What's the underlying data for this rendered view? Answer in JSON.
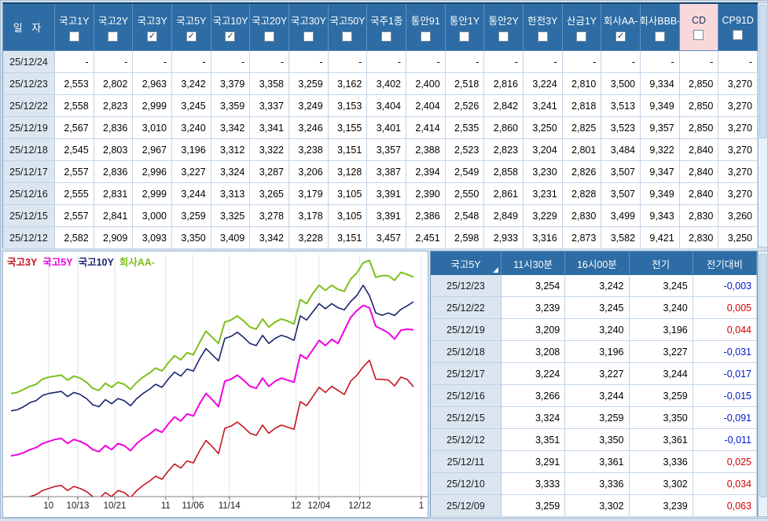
{
  "colors": {
    "header_bg": "#2D6CA4",
    "header_highlight_bg": "#F8D8DA",
    "date_col_bg": "#DCE6F1",
    "negative": "#0018C8",
    "positive": "#D40000"
  },
  "top_table": {
    "date_header": "일  자",
    "columns": [
      {
        "label": "국고1Y",
        "checked": false,
        "highlight": false
      },
      {
        "label": "국고2Y",
        "checked": false,
        "highlight": false
      },
      {
        "label": "국고3Y",
        "checked": true,
        "highlight": false
      },
      {
        "label": "국고5Y",
        "checked": true,
        "highlight": false
      },
      {
        "label": "국고10Y",
        "checked": true,
        "highlight": false
      },
      {
        "label": "국고20Y",
        "checked": false,
        "highlight": false
      },
      {
        "label": "국고30Y",
        "checked": false,
        "highlight": false
      },
      {
        "label": "국고50Y",
        "checked": false,
        "highlight": false
      },
      {
        "label": "국주1종",
        "checked": false,
        "highlight": false
      },
      {
        "label": "통안91",
        "checked": false,
        "highlight": false
      },
      {
        "label": "통안1Y",
        "checked": false,
        "highlight": false
      },
      {
        "label": "통안2Y",
        "checked": false,
        "highlight": false
      },
      {
        "label": "한전3Y",
        "checked": false,
        "highlight": false
      },
      {
        "label": "산금1Y",
        "checked": false,
        "highlight": false
      },
      {
        "label": "회사AA-",
        "checked": true,
        "highlight": false
      },
      {
        "label": "회사BBB-",
        "checked": false,
        "highlight": false
      },
      {
        "label": "CD",
        "checked": false,
        "highlight": true
      },
      {
        "label": "CP91D",
        "checked": false,
        "highlight": false
      }
    ],
    "rows": [
      {
        "date": "25/12/24",
        "values": [
          "-",
          "-",
          "-",
          "-",
          "-",
          "-",
          "-",
          "-",
          "-",
          "-",
          "-",
          "-",
          "-",
          "-",
          "-",
          "-",
          "-",
          "-"
        ]
      },
      {
        "date": "25/12/23",
        "values": [
          "2,553",
          "2,802",
          "2,963",
          "3,242",
          "3,379",
          "3,358",
          "3,259",
          "3,162",
          "3,402",
          "2,400",
          "2,518",
          "2,816",
          "3,224",
          "2,810",
          "3,500",
          "9,334",
          "2,850",
          "3,270"
        ]
      },
      {
        "date": "25/12/22",
        "values": [
          "2,558",
          "2,823",
          "2,999",
          "3,245",
          "3,359",
          "3,337",
          "3,249",
          "3,153",
          "3,404",
          "2,404",
          "2,526",
          "2,842",
          "3,241",
          "2,818",
          "3,513",
          "9,349",
          "2,850",
          "3,270"
        ]
      },
      {
        "date": "25/12/19",
        "values": [
          "2,567",
          "2,836",
          "3,010",
          "3,240",
          "3,342",
          "3,341",
          "3,246",
          "3,155",
          "3,401",
          "2,414",
          "2,535",
          "2,860",
          "3,250",
          "2,825",
          "3,523",
          "9,357",
          "2,850",
          "3,270"
        ]
      },
      {
        "date": "25/12/18",
        "values": [
          "2,545",
          "2,803",
          "2,967",
          "3,196",
          "3,312",
          "3,322",
          "3,238",
          "3,151",
          "3,357",
          "2,388",
          "2,523",
          "2,823",
          "3,204",
          "2,801",
          "3,484",
          "9,322",
          "2,840",
          "3,270"
        ]
      },
      {
        "date": "25/12/17",
        "values": [
          "2,557",
          "2,836",
          "2,996",
          "3,227",
          "3,324",
          "3,287",
          "3,206",
          "3,128",
          "3,387",
          "2,394",
          "2,549",
          "2,858",
          "3,230",
          "2,826",
          "3,507",
          "9,347",
          "2,840",
          "3,270"
        ]
      },
      {
        "date": "25/12/16",
        "values": [
          "2,555",
          "2,831",
          "2,999",
          "3,244",
          "3,313",
          "3,265",
          "3,179",
          "3,105",
          "3,391",
          "2,390",
          "2,550",
          "2,861",
          "3,231",
          "2,828",
          "3,507",
          "9,349",
          "2,840",
          "3,270"
        ]
      },
      {
        "date": "25/12/15",
        "values": [
          "2,557",
          "2,841",
          "3,000",
          "3,259",
          "3,325",
          "3,278",
          "3,178",
          "3,105",
          "3,391",
          "2,386",
          "2,548",
          "2,849",
          "3,229",
          "2,830",
          "3,499",
          "9,343",
          "2,830",
          "3,260"
        ]
      },
      {
        "date": "25/12/12",
        "values": [
          "2,582",
          "2,909",
          "3,093",
          "3,350",
          "3,409",
          "3,342",
          "3,228",
          "3,151",
          "3,457",
          "2,451",
          "2,598",
          "2,933",
          "3,316",
          "2,873",
          "3,582",
          "9,421",
          "2,830",
          "3,250"
        ]
      }
    ]
  },
  "quote_table": {
    "title": "국고5Y",
    "columns": [
      "11시30분",
      "16시00분",
      "전기",
      "전기대비"
    ],
    "rows": [
      {
        "date": "25/12/23",
        "values": [
          "3,254",
          "3,242",
          "3,245"
        ],
        "diff": "-0,003"
      },
      {
        "date": "25/12/22",
        "values": [
          "3,239",
          "3,245",
          "3,240"
        ],
        "diff": "0,005"
      },
      {
        "date": "25/12/19",
        "values": [
          "3,209",
          "3,240",
          "3,196"
        ],
        "diff": "0,044"
      },
      {
        "date": "25/12/18",
        "values": [
          "3,208",
          "3,196",
          "3,227"
        ],
        "diff": "-0,031"
      },
      {
        "date": "25/12/17",
        "values": [
          "3,224",
          "3,227",
          "3,244"
        ],
        "diff": "-0,017"
      },
      {
        "date": "25/12/16",
        "values": [
          "3,266",
          "3,244",
          "3,259"
        ],
        "diff": "-0,015"
      },
      {
        "date": "25/12/15",
        "values": [
          "3,324",
          "3,259",
          "3,350"
        ],
        "diff": "-0,091"
      },
      {
        "date": "25/12/12",
        "values": [
          "3,351",
          "3,350",
          "3,361"
        ],
        "diff": "-0,011"
      },
      {
        "date": "25/12/11",
        "values": [
          "3,291",
          "3,361",
          "3,336"
        ],
        "diff": "0,025"
      },
      {
        "date": "25/12/10",
        "values": [
          "3,333",
          "3,336",
          "3,302"
        ],
        "diff": "0,034"
      },
      {
        "date": "25/12/09",
        "values": [
          "3,259",
          "3,302",
          "3,239"
        ],
        "diff": "0,063"
      }
    ]
  },
  "chart_data": {
    "type": "line",
    "title": "",
    "xlabel": "",
    "ylabel": "",
    "legend_position": "top-left",
    "grid": "vertical-only",
    "y_min": 2.425,
    "y_max": 3.61,
    "x_ticks": [
      {
        "label": "10",
        "pos": 0.107
      },
      {
        "label": "10/13",
        "pos": 0.176
      },
      {
        "label": "10/21",
        "pos": 0.263
      },
      {
        "label": "11",
        "pos": 0.383
      },
      {
        "label": "11/06",
        "pos": 0.447
      },
      {
        "label": "11/14",
        "pos": 0.533
      },
      {
        "label": "12",
        "pos": 0.69
      },
      {
        "label": "12/04",
        "pos": 0.744
      },
      {
        "label": "12/12",
        "pos": 0.84
      },
      {
        "label": "1",
        "pos": 0.985
      }
    ],
    "x": [
      "09/22",
      "09/23",
      "09/24",
      "09/25",
      "09/26",
      "09/29",
      "09/30",
      "10/01",
      "10/02",
      "10/06",
      "10/07",
      "10/08",
      "10/10",
      "10/13",
      "10/14",
      "10/15",
      "10/16",
      "10/17",
      "10/20",
      "10/21",
      "10/22",
      "10/23",
      "10/24",
      "10/27",
      "10/28",
      "10/29",
      "10/30",
      "10/31",
      "11/03",
      "11/04",
      "11/05",
      "11/06",
      "11/07",
      "11/10",
      "11/11",
      "11/12",
      "11/13",
      "11/14",
      "11/17",
      "11/18",
      "11/19",
      "11/20",
      "11/21",
      "11/24",
      "11/25",
      "11/26",
      "11/27",
      "11/28",
      "12/01",
      "12/02",
      "12/03",
      "12/04",
      "12/05",
      "12/08",
      "12/09",
      "12/10",
      "12/11",
      "12/12",
      "12/15",
      "12/16",
      "12/17",
      "12/18",
      "12/19",
      "12/22",
      "12/23"
    ],
    "series": [
      {
        "name": "국고3Y",
        "color": "#C41422",
        "width": 1.6,
        "values": [
          2.395,
          2.4,
          2.41,
          2.425,
          2.435,
          2.455,
          2.465,
          2.475,
          2.48,
          2.455,
          2.475,
          2.465,
          2.45,
          2.425,
          2.415,
          2.445,
          2.425,
          2.455,
          2.445,
          2.42,
          2.455,
          2.48,
          2.5,
          2.525,
          2.51,
          2.55,
          2.585,
          2.565,
          2.6,
          2.59,
          2.65,
          2.7,
          2.67,
          2.635,
          2.76,
          2.77,
          2.79,
          2.765,
          2.735,
          2.725,
          2.775,
          2.735,
          2.76,
          2.775,
          2.765,
          2.755,
          2.89,
          2.87,
          2.915,
          2.96,
          2.935,
          2.965,
          2.945,
          2.925,
          2.99,
          3.02,
          3.06,
          3.093,
          3.0,
          2.999,
          2.996,
          2.967,
          3.01,
          2.999,
          2.963
        ]
      },
      {
        "name": "국고5Y",
        "color": "#F000E0",
        "width": 2,
        "values": [
          2.625,
          2.63,
          2.64,
          2.655,
          2.665,
          2.685,
          2.695,
          2.705,
          2.71,
          2.685,
          2.705,
          2.695,
          2.68,
          2.655,
          2.645,
          2.675,
          2.655,
          2.685,
          2.675,
          2.65,
          2.685,
          2.71,
          2.73,
          2.755,
          2.74,
          2.78,
          2.815,
          2.795,
          2.83,
          2.82,
          2.88,
          2.93,
          2.9,
          2.865,
          2.99,
          3.0,
          3.02,
          2.995,
          2.965,
          2.955,
          3.005,
          2.965,
          2.99,
          3.005,
          2.995,
          2.985,
          3.12,
          3.1,
          3.145,
          3.19,
          3.165,
          3.195,
          3.175,
          3.239,
          3.302,
          3.336,
          3.361,
          3.35,
          3.259,
          3.244,
          3.227,
          3.196,
          3.24,
          3.245,
          3.242
        ]
      },
      {
        "name": "국고10Y",
        "color": "#1A2470",
        "width": 1.6,
        "values": [
          2.845,
          2.85,
          2.865,
          2.885,
          2.895,
          2.92,
          2.93,
          2.935,
          2.94,
          2.915,
          2.935,
          2.925,
          2.905,
          2.875,
          2.865,
          2.9,
          2.88,
          2.905,
          2.895,
          2.87,
          2.905,
          2.93,
          2.95,
          2.975,
          2.96,
          3.0,
          3.035,
          3.015,
          3.05,
          3.04,
          3.1,
          3.15,
          3.12,
          3.09,
          3.2,
          3.21,
          3.23,
          3.205,
          3.175,
          3.165,
          3.215,
          3.175,
          3.2,
          3.215,
          3.205,
          3.19,
          3.31,
          3.29,
          3.33,
          3.37,
          3.345,
          3.37,
          3.35,
          3.34,
          3.38,
          3.41,
          3.46,
          3.409,
          3.325,
          3.313,
          3.324,
          3.312,
          3.342,
          3.359,
          3.379
        ]
      },
      {
        "name": "회사AA-",
        "color": "#7CC01C",
        "width": 2,
        "values": [
          2.93,
          2.935,
          2.95,
          2.965,
          2.975,
          3.0,
          3.01,
          3.015,
          3.02,
          2.995,
          3.015,
          3.005,
          2.985,
          2.955,
          2.945,
          2.98,
          2.96,
          2.985,
          2.975,
          2.95,
          2.985,
          3.01,
          3.03,
          3.055,
          3.04,
          3.08,
          3.115,
          3.095,
          3.13,
          3.12,
          3.18,
          3.235,
          3.205,
          3.175,
          3.28,
          3.29,
          3.31,
          3.285,
          3.255,
          3.245,
          3.295,
          3.255,
          3.28,
          3.295,
          3.285,
          3.27,
          3.39,
          3.37,
          3.42,
          3.46,
          3.435,
          3.46,
          3.44,
          3.43,
          3.49,
          3.52,
          3.57,
          3.582,
          3.499,
          3.507,
          3.507,
          3.484,
          3.523,
          3.513,
          3.5
        ]
      }
    ]
  }
}
